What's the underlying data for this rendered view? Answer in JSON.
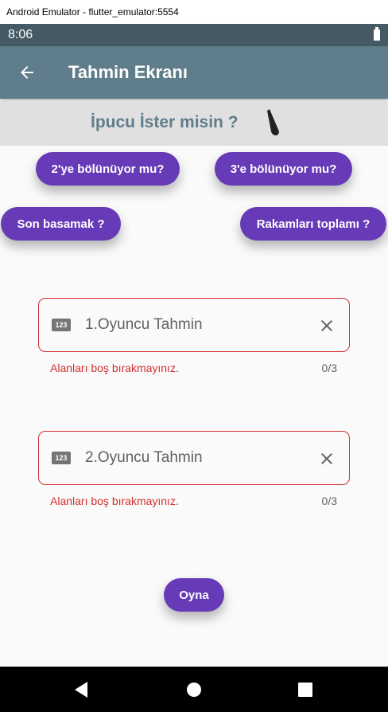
{
  "window": {
    "title": "Android Emulator - flutter_emulator:5554"
  },
  "status_bar": {
    "time": "8:06"
  },
  "app_bar": {
    "title": "Tahmin Ekranı"
  },
  "hint": {
    "title": "İpucu İster misin ?"
  },
  "hint_buttons": [
    {
      "label": "2'ye bölünüyor mu?"
    },
    {
      "label": "3'e bölünüyor mu?"
    },
    {
      "label": "Son basamak ?"
    },
    {
      "label": "Rakamları toplamı ?"
    }
  ],
  "fields": [
    {
      "placeholder": "1.Oyuncu Tahmin",
      "icon_text": "123",
      "error": "Alanları boş bırakmayınız.",
      "counter": "0/3"
    },
    {
      "placeholder": "2.Oyuncu Tahmin",
      "icon_text": "123",
      "error": "Alanları boş bırakmayınız.",
      "counter": "0/3"
    }
  ],
  "play_button": {
    "label": "Oyna"
  },
  "colors": {
    "accent": "#673ab7",
    "app_bar": "#607d8b",
    "status_bar": "#455a64",
    "error": "#d32f2f",
    "hint_bg": "#e0e0e0"
  }
}
